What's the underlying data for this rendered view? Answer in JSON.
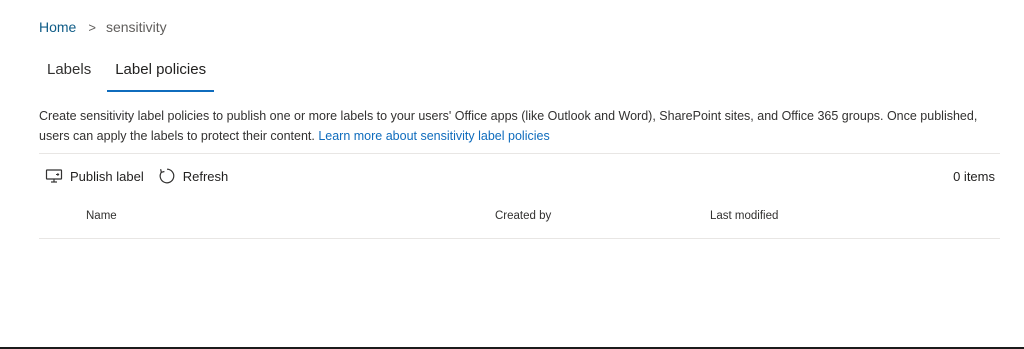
{
  "breadcrumb": {
    "home": "Home",
    "separator": ">",
    "current": "sensitivity"
  },
  "tabs": [
    {
      "label": "Labels",
      "selected": false
    },
    {
      "label": "Label policies",
      "selected": true
    }
  ],
  "description": {
    "text": "Create sensitivity label policies to publish one or more labels to your users' Office apps (like Outlook and Word), SharePoint sites, and Office 365 groups. Once published, users can apply the labels to protect their content.",
    "link": "Learn more about sensitivity label policies"
  },
  "toolbar": {
    "publish_label": "Publish label",
    "publish_icon": "publish-icon",
    "refresh_label": "Refresh",
    "refresh_icon": "refresh-icon",
    "items_count": "0 items"
  },
  "table": {
    "columns": [
      "Name",
      "Created by",
      "Last modified"
    ]
  },
  "colors": {
    "accent": "#0f6cbd",
    "link": "#0f6cbd",
    "breadcrumb_link": "#0f5c87"
  }
}
